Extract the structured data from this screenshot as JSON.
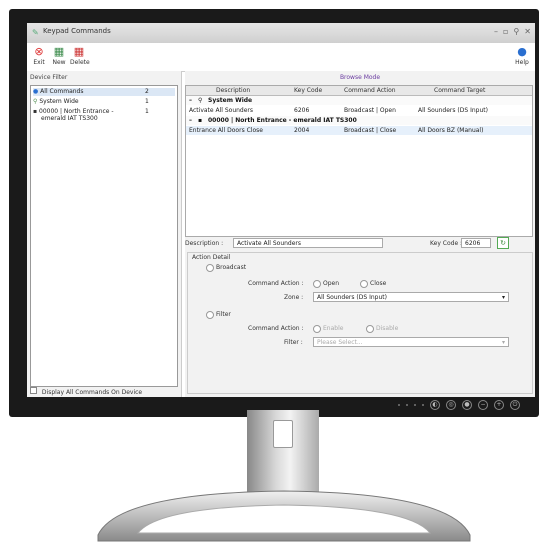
{
  "window": {
    "title": "Keypad Commands",
    "controls": [
      "–",
      "▫",
      "⚲",
      "✕"
    ]
  },
  "toolbar": {
    "exit_label": "Exit",
    "new_label": "New",
    "delete_label": "Delete",
    "help_label": "Help"
  },
  "sidebar": {
    "header": "Device Filter",
    "items": [
      {
        "label": "All Commands",
        "count": "2"
      },
      {
        "label": "System Wide",
        "count": "1"
      },
      {
        "label": "00000 | North Entrance -",
        "label2": "emerald IAT TS300",
        "count": "1"
      }
    ],
    "footer_checkbox": "Display All Commands On Device"
  },
  "main": {
    "mode": "Browse Mode",
    "columns": [
      "Description",
      "Key Code",
      "Command Action",
      "Command Target"
    ],
    "groups": [
      {
        "name": "System Wide",
        "rows": [
          [
            "Activate All Sounders",
            "6206",
            "Broadcast | Open",
            "All Sounders (DS Input)"
          ]
        ]
      },
      {
        "name": "00000 | North Entrance - emerald IAT TS300",
        "rows": [
          [
            "Entrance All Doors Close",
            "2004",
            "Broadcast | Close",
            "All Doors BZ (Manual)"
          ]
        ]
      }
    ]
  },
  "detail": {
    "description_label": "Description :",
    "description_value": "Activate All Sounders",
    "keycode_label": "Key Code :",
    "keycode_value": "6206",
    "action_detail": "Action Detail",
    "broadcast_label": "Broadcast",
    "command_action_label": "Command Action :",
    "open_label": "Open",
    "close_label": "Close",
    "zone_label": "Zone :",
    "zone_value": "All Sounders (DS Input)",
    "filter_label": "Filter",
    "command_action2_label": "Command Action :",
    "enable_label": "Enable",
    "disable_label": "Disable",
    "filter_field_label": "Filter :",
    "filter_placeholder": "Please Select..."
  }
}
